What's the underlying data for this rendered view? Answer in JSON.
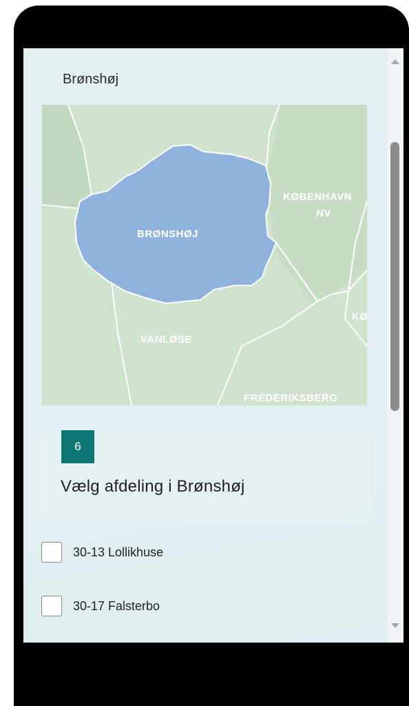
{
  "section": {
    "title": "Brønshøj"
  },
  "map": {
    "labels": {
      "bronshoj": "BRØNSHØJ",
      "kobenhavn_nv_line1": "KØBENHAVN",
      "kobenhavn_nv_line2": "NV",
      "vanlose": "VANLØSE",
      "frederiksberg": "FREDERIKSBERG",
      "partial": "KØ"
    },
    "colors": {
      "base": "#cfe3cf",
      "region": "#8fb2dc",
      "region_border": "#ffffff",
      "highlight_label": "#ffffff"
    }
  },
  "question": {
    "number": "6",
    "text": "Vælg afdeling i Brønshøj"
  },
  "options": [
    {
      "label": "30-13 Lollikhuse",
      "checked": false
    },
    {
      "label": "30-17 Falsterbo",
      "checked": false
    }
  ],
  "colors": {
    "accent": "#0e7675",
    "background": "#e4eff2"
  },
  "icons": {
    "scroll_up": "chevron-up-icon",
    "scroll_down": "chevron-down-icon"
  }
}
